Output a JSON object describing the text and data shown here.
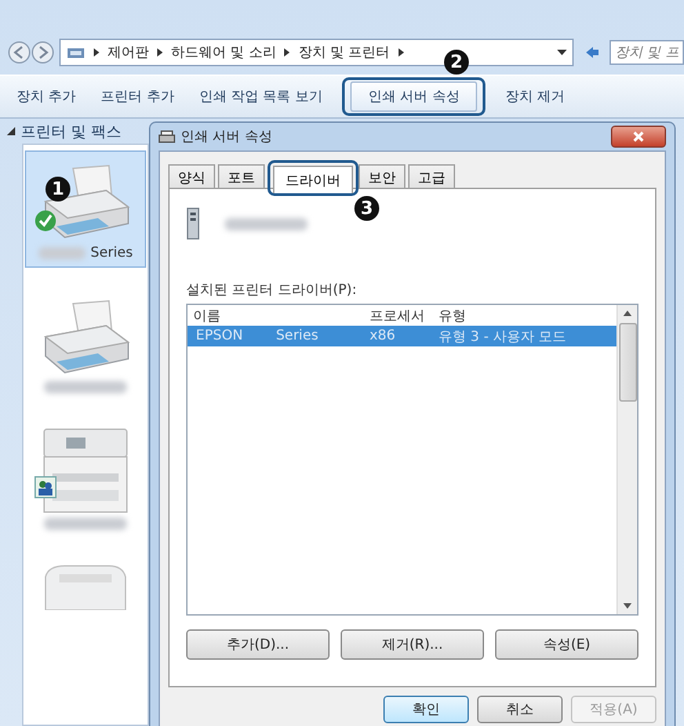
{
  "address_bar": {
    "path": [
      "제어판",
      "하드웨어 및 소리",
      "장치 및 프린터"
    ],
    "search": {
      "placeholder": "장치 및 프"
    }
  },
  "toolbar": [
    {
      "label": "장치 추가",
      "highlighted": false
    },
    {
      "label": "프린터 추가",
      "highlighted": false
    },
    {
      "label": "인쇄 작업 목록 보기",
      "highlighted": false
    },
    {
      "label": "인쇄 서버 속성",
      "highlighted": true
    },
    {
      "label": "장치 제거",
      "highlighted": false
    }
  ],
  "navigation": {
    "label": "프린터 및 팩스"
  },
  "devices": [
    {
      "kind": "inkjet",
      "label": "Series",
      "selected": true,
      "default": true,
      "shared": false
    },
    {
      "kind": "inkjet",
      "selected": false,
      "default": false,
      "shared": false
    },
    {
      "kind": "office",
      "selected": false,
      "default": false,
      "shared": true
    },
    {
      "kind": "laser",
      "selected": false,
      "default": false,
      "shared": false
    }
  ],
  "dialog": {
    "title": "인쇄 서버 속성",
    "tabs": [
      {
        "label": "양식",
        "selected": false,
        "highlighted": false
      },
      {
        "label": "포트",
        "selected": false,
        "highlighted": false
      },
      {
        "label": "드라이버",
        "selected": true,
        "highlighted": true
      },
      {
        "label": "보안",
        "selected": false,
        "highlighted": false
      },
      {
        "label": "고급",
        "selected": false,
        "highlighted": false
      }
    ],
    "drivers_label": "설치된 프린터 드라이버(P):",
    "columns": [
      "이름",
      "프로세서",
      "유형"
    ],
    "rows": [
      {
        "name": [
          "EPSON",
          "Series"
        ],
        "processor": "x86",
        "type": "유형 3 - 사용자 모드",
        "selected": true
      }
    ],
    "actions": [
      "추가(D)...",
      "제거(R)...",
      "속성(E)"
    ],
    "buttons": [
      {
        "label": "확인",
        "default": true,
        "disabled": false
      },
      {
        "label": "취소",
        "default": false,
        "disabled": false
      },
      {
        "label": "적용(A)",
        "default": false,
        "disabled": true
      }
    ]
  },
  "callouts": [
    {
      "number": "1"
    },
    {
      "number": "2"
    },
    {
      "number": "3"
    }
  ]
}
